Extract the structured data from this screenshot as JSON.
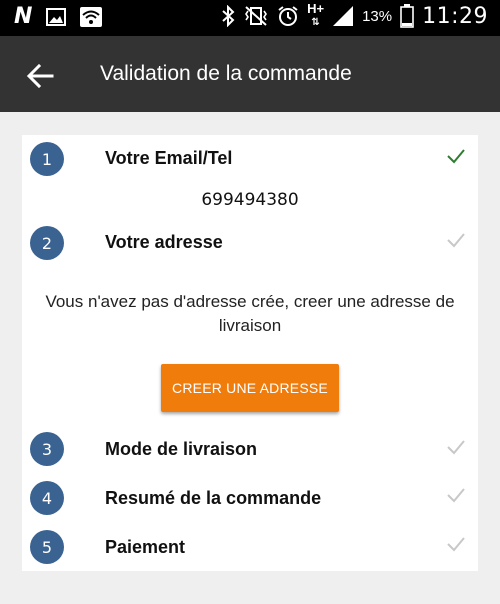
{
  "status_bar": {
    "battery_percent": "13%",
    "time": "11:29",
    "network_type": "H+",
    "icons": [
      "n-logo-icon",
      "image-icon",
      "wifi-icon",
      "bluetooth-icon",
      "vibrate-icon",
      "alarm-icon",
      "signal-icon",
      "battery-icon"
    ]
  },
  "app_bar": {
    "title": "Validation de la commande",
    "back_icon": "arrow-back-icon"
  },
  "steps": [
    {
      "number": "1",
      "label": "Votre Email/Tel",
      "value": "699494380",
      "completed": true
    },
    {
      "number": "2",
      "label": "Votre adresse",
      "message": "Vous n'avez pas d'adresse crée, creer une adresse de livraison",
      "button_label": "CREER UNE ADRESSE",
      "completed": false
    },
    {
      "number": "3",
      "label": "Mode de livraison",
      "completed": false
    },
    {
      "number": "4",
      "label": "Resumé de la commande",
      "completed": false
    },
    {
      "number": "5",
      "label": "Paiement",
      "completed": false
    }
  ],
  "colors": {
    "step_circle": "#3a6391",
    "check_done": "#2e7d32",
    "check_pending": "#c8c8c8",
    "button": "#f07c0c",
    "app_bar": "#333333"
  }
}
